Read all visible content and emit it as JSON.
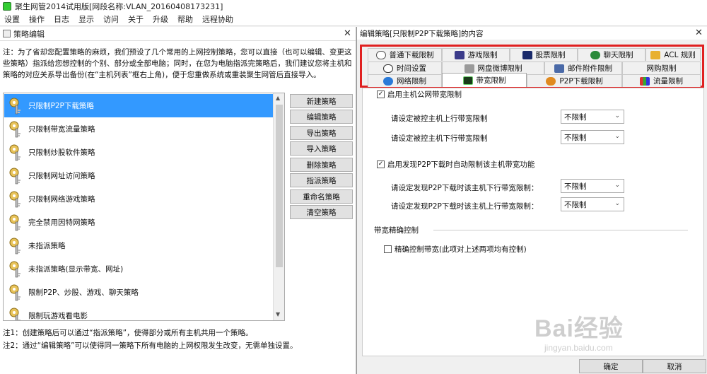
{
  "window": {
    "title": "聚生网管2014试用版[网段名称:VLAN_20160408173231]"
  },
  "menu": [
    "设置",
    "操作",
    "日志",
    "显示",
    "访问",
    "关于",
    "升级",
    "帮助",
    "远程协助"
  ],
  "policy_editor": {
    "title": "策略编辑",
    "note": "注：为了省却您配置策略的麻烦，我们预设了几个常用的上网控制策略，您可以直接（也可以编辑、变更这些策略）指派给您想控制的个别、部分或全部电脑；同时，在您为电脑指派完策略后，我们建议您将主机和策略的对应关系导出备份(在“主机列表”框右上角)，便于您重做系统或重装聚生网管后直接导入。",
    "policies": [
      {
        "label": "只限制P2P下载策略",
        "selected": true
      },
      {
        "label": "只限制带宽流量策略",
        "selected": false
      },
      {
        "label": "只限制炒股软件策略",
        "selected": false
      },
      {
        "label": "只限制网址访问策略",
        "selected": false
      },
      {
        "label": "只限制网络游戏策略",
        "selected": false
      },
      {
        "label": "完全禁用因特网策略",
        "selected": false
      },
      {
        "label": "未指派策略",
        "selected": false
      },
      {
        "label": "未指派策略(显示带宽、网址)",
        "selected": false
      },
      {
        "label": "限制P2P、炒股、游戏、聊天策略",
        "selected": false
      },
      {
        "label": "限制玩游戏看电影",
        "selected": false
      }
    ],
    "buttons": [
      "新建策略",
      "编辑策略",
      "导出策略",
      "导入策略",
      "删除策略",
      "指派策略",
      "重命名策略",
      "清空策略"
    ],
    "footnote1": "注1：创建策略后可以通过“指派策略”，使得部分或所有主机共用一个策略。",
    "footnote2": "注2：通过“编辑策略”可以使得同一策略下所有电脑的上网权限发生改变，无需单独设置。"
  },
  "edit_dialog": {
    "title": "编辑策略[只限制P2P下载策略]的内容",
    "tabs_row1": [
      {
        "label": "普通下载限制",
        "icon": "download-icon"
      },
      {
        "label": "游戏限制",
        "icon": "game-icon"
      },
      {
        "label": "股票限制",
        "icon": "stock-icon"
      },
      {
        "label": "聊天限制",
        "icon": "chat-icon"
      },
      {
        "label": "ACL 规则",
        "icon": "acl-icon"
      }
    ],
    "tabs_row2": [
      {
        "label": "时间设置",
        "icon": "clock-icon"
      },
      {
        "label": "网盘微博限制",
        "icon": "cloud-icon"
      },
      {
        "label": "邮件附件限制",
        "icon": "mail-icon"
      },
      {
        "label": "网购限制",
        "icon": ""
      }
    ],
    "tabs_row3": [
      {
        "label": "网络限制",
        "icon": "globe-icon"
      },
      {
        "label": "带宽限制",
        "icon": "bandwidth-icon"
      },
      {
        "label": "P2P下载限制",
        "icon": "p2p-icon"
      },
      {
        "label": "流量限制",
        "icon": "traffic-icon"
      }
    ],
    "enable_public_bw": "启用主机公网带宽限制",
    "upload_label": "请设定被控主机上行带宽限制",
    "download_label": "请设定被控主机下行带宽限制",
    "upload_value": "不限制",
    "download_value": "不限制",
    "enable_p2p_auto": "启用发现P2P下载时自动限制该主机带宽功能",
    "p2p_down_label": "请设定发现P2P下载时该主机下行带宽限制：",
    "p2p_up_label": "请设定发现P2P下载时该主机上行带宽限制：",
    "p2p_down_value": "不限制",
    "p2p_up_value": "不限制",
    "precise_group": "带宽精确控制",
    "precise_check": "精确控制带宽(此项对上述两项均有控制)",
    "ok": "确定",
    "cancel": "取消"
  },
  "watermark": {
    "brand": "Bai经验",
    "url": "jingyan.baidu.com"
  },
  "colors": {
    "selection": "#3399ff",
    "highlight_border": "#e02020"
  }
}
